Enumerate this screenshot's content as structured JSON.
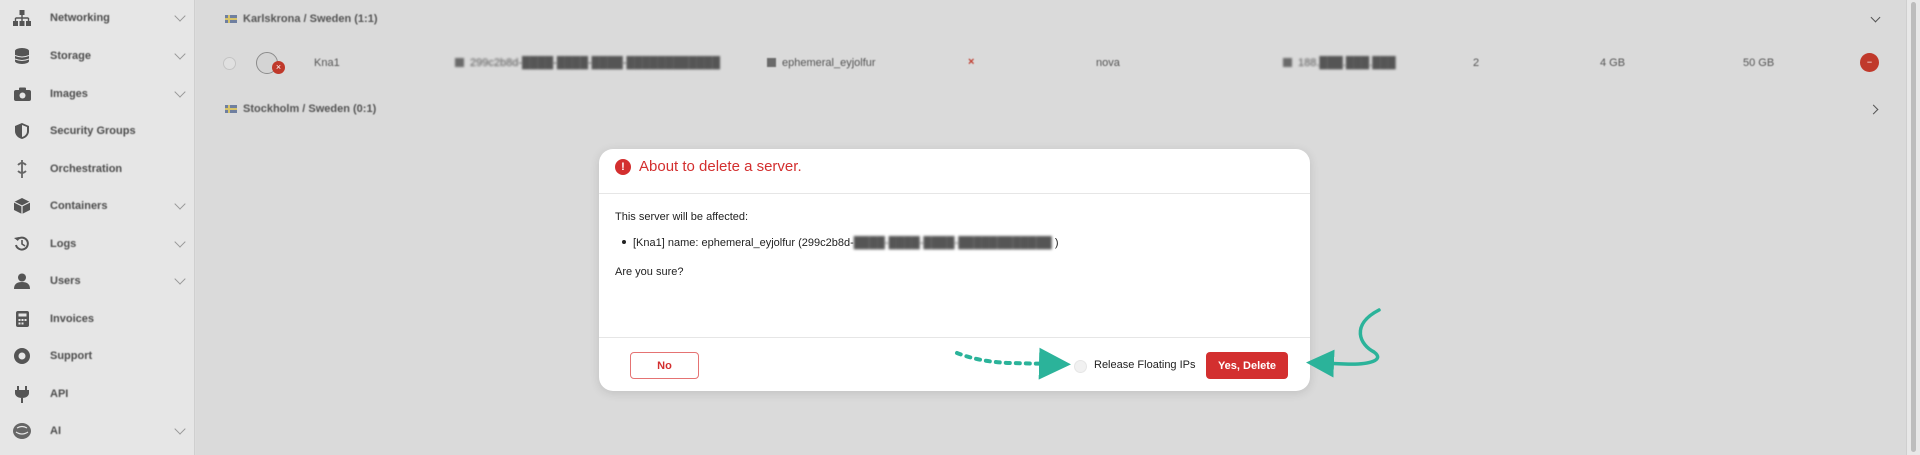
{
  "sidebar": {
    "items": [
      {
        "label": "Networking",
        "icon": "network-icon",
        "has_children": true
      },
      {
        "label": "Storage",
        "icon": "storage-icon",
        "has_children": true
      },
      {
        "label": "Images",
        "icon": "camera-icon",
        "has_children": true
      },
      {
        "label": "Security Groups",
        "icon": "shield-icon",
        "has_children": false
      },
      {
        "label": "Orchestration",
        "icon": "orchestration-icon",
        "has_children": false
      },
      {
        "label": "Containers",
        "icon": "box-icon",
        "has_children": true
      },
      {
        "label": "Logs",
        "icon": "history-icon",
        "has_children": true
      },
      {
        "label": "Users",
        "icon": "user-icon",
        "has_children": true
      },
      {
        "label": "Invoices",
        "icon": "invoice-icon",
        "has_children": false
      },
      {
        "label": "Support",
        "icon": "support-icon",
        "has_children": false
      },
      {
        "label": "API",
        "icon": "plug-icon",
        "has_children": false
      },
      {
        "label": "AI",
        "icon": "ai-icon",
        "has_children": true
      }
    ]
  },
  "regions": [
    {
      "label": "Karlskrona / Sweden (1:1)"
    },
    {
      "label": "Stockholm / Sweden (0:1)"
    }
  ],
  "server_row": {
    "name": "Kna1",
    "id": "299c2b8d-████-████-████-████████████",
    "display_name": "ephemeral_eyjolfur",
    "status_mark": "×",
    "flavor_type": "nova",
    "ip": "188.███.███.███",
    "vcpus": "2",
    "ram": "4 GB",
    "disk": "50 GB",
    "delete_glyph": "−"
  },
  "dialog": {
    "title": "About to delete a server.",
    "icon": "exclamation-icon",
    "affected_text": "This server will be affected:",
    "server_item_prefix": "[Kna1] name: ephemeral_eyjolfur (299c2b8d-",
    "server_item_redacted": "████-████-████-████████████",
    "server_item_suffix": " )",
    "question": "Are you sure?",
    "no_label": "No",
    "release_label": "Release Floating IPs",
    "yes_label": "Yes, Delete"
  },
  "colors": {
    "danger": "#d32f2f",
    "annotation": "#2bb39a"
  }
}
